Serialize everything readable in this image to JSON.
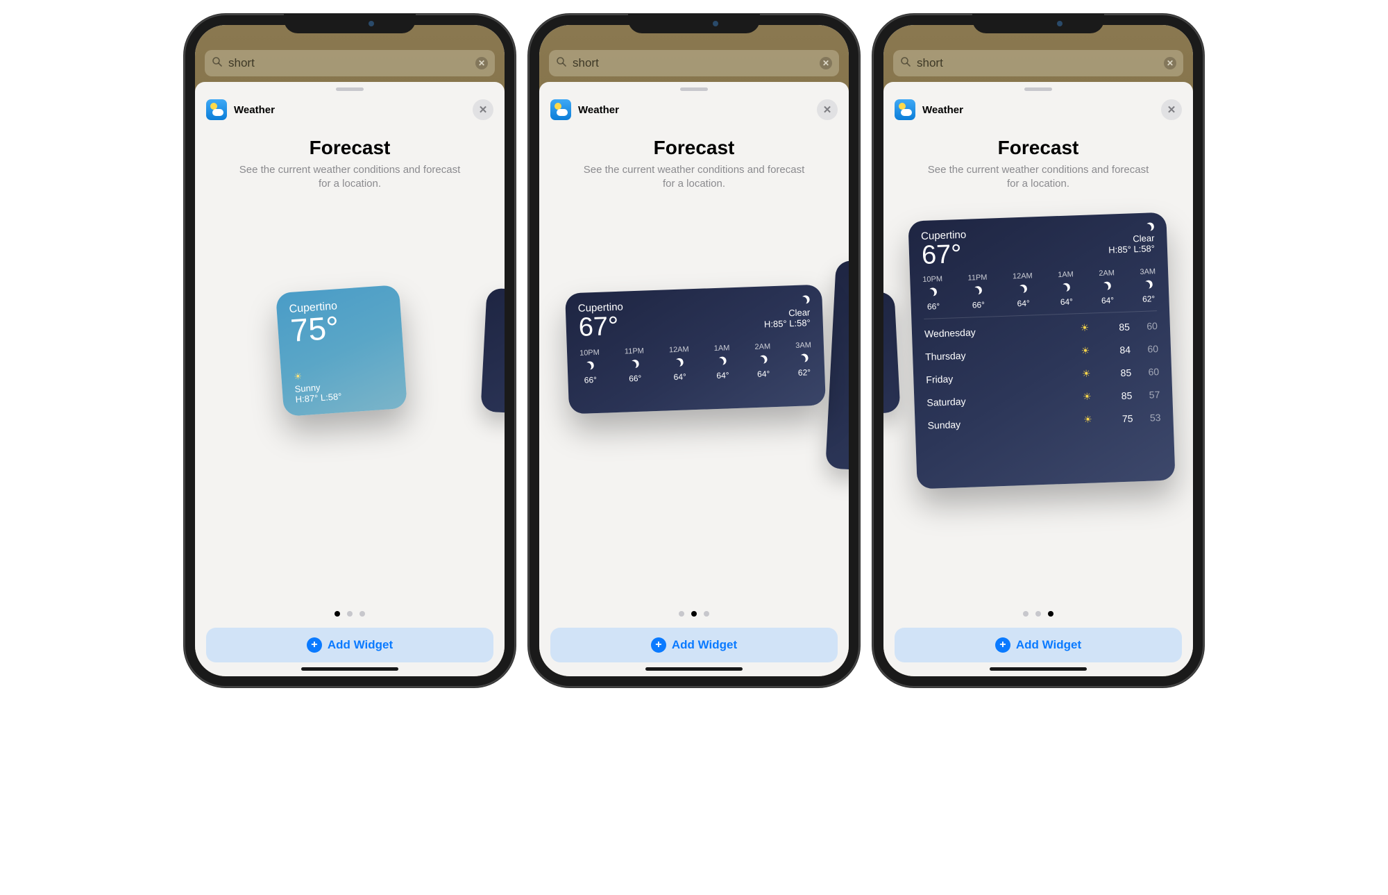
{
  "search": {
    "query": "short"
  },
  "sheet": {
    "app_name": "Weather",
    "title": "Forecast",
    "subtitle_line1": "See the current weather conditions and forecast",
    "subtitle_line2": "for a location.",
    "add_button": "Add Widget"
  },
  "panes": [
    {
      "page_index": 0,
      "widget_size": "small",
      "location": "Cupertino",
      "temp": "75°",
      "condition": "Sunny",
      "hi_lo": "H:87° L:58°"
    },
    {
      "page_index": 1,
      "widget_size": "medium",
      "location": "Cupertino",
      "temp": "67°",
      "condition": "Clear",
      "hi_lo": "H:85° L:58°",
      "hourly": [
        {
          "time": "10PM",
          "temp": "66°"
        },
        {
          "time": "11PM",
          "temp": "66°"
        },
        {
          "time": "12AM",
          "temp": "64°"
        },
        {
          "time": "1AM",
          "temp": "64°"
        },
        {
          "time": "2AM",
          "temp": "64°"
        },
        {
          "time": "3AM",
          "temp": "62°"
        }
      ]
    },
    {
      "page_index": 2,
      "widget_size": "large",
      "location": "Cupertino",
      "temp": "67°",
      "condition": "Clear",
      "hi_lo": "H:85° L:58°",
      "hourly": [
        {
          "time": "10PM",
          "temp": "66°"
        },
        {
          "time": "11PM",
          "temp": "66°"
        },
        {
          "time": "12AM",
          "temp": "64°"
        },
        {
          "time": "1AM",
          "temp": "64°"
        },
        {
          "time": "2AM",
          "temp": "64°"
        },
        {
          "time": "3AM",
          "temp": "62°"
        }
      ],
      "daily": [
        {
          "day": "Wednesday",
          "hi": "85",
          "lo": "60"
        },
        {
          "day": "Thursday",
          "hi": "84",
          "lo": "60"
        },
        {
          "day": "Friday",
          "hi": "85",
          "lo": "60"
        },
        {
          "day": "Saturday",
          "hi": "85",
          "lo": "57"
        },
        {
          "day": "Sunday",
          "hi": "75",
          "lo": "53"
        }
      ]
    }
  ],
  "page_count": 3
}
